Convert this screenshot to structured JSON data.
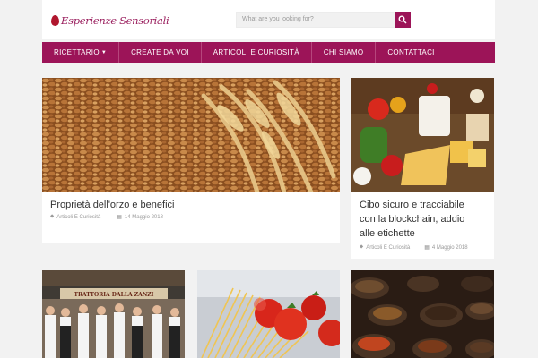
{
  "site": {
    "logo_text": "Esperienze Sensoriali",
    "search_placeholder": "What are you looking for?"
  },
  "nav": {
    "items": [
      {
        "label": "RICETTARIO",
        "has_dropdown": true
      },
      {
        "label": "CREATE DA VOI"
      },
      {
        "label": "ARTICOLI E CURIOSITÀ"
      },
      {
        "label": "CHI SIAMO"
      },
      {
        "label": "CONTATTACI"
      }
    ]
  },
  "posts": [
    {
      "title": "Proprietà dell'orzo e benefici",
      "category": "Articoli E Curiosità",
      "date": "14 Maggio 2018",
      "image": "grain-wheat"
    },
    {
      "title_lines": [
        "Cibo sicuro e tracciabile",
        "con la blockchain, addio",
        "alle etichette"
      ],
      "category": "Articoli E Curiosità",
      "date": "4 Maggio 2018",
      "image": "food-table"
    },
    {
      "image": "staff-trattoria"
    },
    {
      "image": "pasta-tomatoes"
    },
    {
      "image": "spice-bowls"
    }
  ],
  "colors": {
    "accent": "#9c1458",
    "background": "#f2f2f2",
    "text": "#333333",
    "meta": "#9a9a9a"
  }
}
